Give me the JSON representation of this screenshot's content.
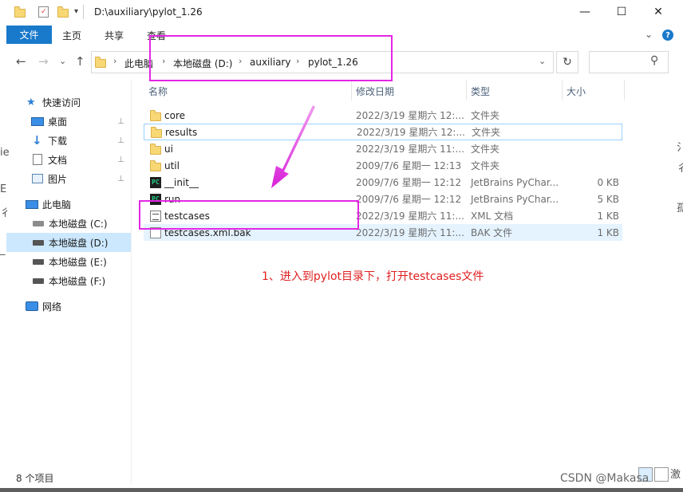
{
  "window": {
    "title": "D:\\auxiliary\\pylot_1.26",
    "minimize": "—",
    "maximize": "☐",
    "close": "✕"
  },
  "ribbon": {
    "tabs": [
      "文件",
      "主页",
      "共享",
      "查看"
    ],
    "expand": "⌄",
    "help": "?"
  },
  "address": {
    "back": "←",
    "forward": "→",
    "recent": "⌄",
    "up": "↑",
    "crumbs": [
      "此电脑",
      "本地磁盘 (D:)",
      "auxiliary",
      "pylot_1.26"
    ],
    "sep": "›",
    "dropdown": "⌄",
    "refresh": "↻",
    "search_icon": "⚲"
  },
  "nav": {
    "items": [
      {
        "label": "快速访问",
        "icon": "star-icon",
        "pinned": false,
        "selected": false
      },
      {
        "label": "桌面",
        "icon": "desktop-icon",
        "pinned": true,
        "selected": false
      },
      {
        "label": "下载",
        "icon": "download-icon",
        "pinned": true,
        "selected": false
      },
      {
        "label": "文档",
        "icon": "document-icon",
        "pinned": true,
        "selected": false
      },
      {
        "label": "图片",
        "icon": "pictures-icon",
        "pinned": true,
        "selected": false
      },
      {
        "label": "此电脑",
        "icon": "computer-icon",
        "pinned": false,
        "selected": false
      },
      {
        "label": "本地磁盘 (C:)",
        "icon": "drive-icon",
        "pinned": false,
        "selected": false
      },
      {
        "label": "本地磁盘 (D:)",
        "icon": "drive-icon",
        "pinned": false,
        "selected": true
      },
      {
        "label": "本地磁盘 (E:)",
        "icon": "drive-icon",
        "pinned": false,
        "selected": false
      },
      {
        "label": "本地磁盘 (F:)",
        "icon": "drive-icon",
        "pinned": false,
        "selected": false
      },
      {
        "label": "网络",
        "icon": "network-icon",
        "pinned": false,
        "selected": false
      }
    ],
    "pin_glyph": "📌"
  },
  "columns": {
    "name": "名称",
    "date": "修改日期",
    "type": "类型",
    "size": "大小"
  },
  "files": [
    {
      "name": "core",
      "date": "2022/3/19 星期六 12:...",
      "type": "文件夹",
      "size": "",
      "icon": "folder-icon"
    },
    {
      "name": "results",
      "date": "2022/3/19 星期六 12:...",
      "type": "文件夹",
      "size": "",
      "icon": "folder-icon"
    },
    {
      "name": "ui",
      "date": "2022/3/19 星期六 11:...",
      "type": "文件夹",
      "size": "",
      "icon": "folder-icon"
    },
    {
      "name": "util",
      "date": "2009/7/6 星期一 12:13",
      "type": "文件夹",
      "size": "",
      "icon": "folder-icon"
    },
    {
      "name": "__init__",
      "date": "2009/7/6 星期一 12:12",
      "type": "JetBrains PyChar...",
      "size": "0 KB",
      "icon": "pycharm-icon"
    },
    {
      "name": "run",
      "date": "2009/7/6 星期一 12:12",
      "type": "JetBrains PyChar...",
      "size": "5 KB",
      "icon": "pycharm-icon"
    },
    {
      "name": "testcases",
      "date": "2022/3/19 星期六 11:...",
      "type": "XML 文档",
      "size": "1 KB",
      "icon": "xml-file-icon"
    },
    {
      "name": "testcases.xml.bak",
      "date": "2022/3/19 星期六 11:...",
      "type": "BAK 文件",
      "size": "1 KB",
      "icon": "bak-file-icon"
    }
  ],
  "pc_icon_text": "PC",
  "annotation": {
    "text": "1、进入到pylot目录下，打开testcases文件",
    "color": "#e02020",
    "box_color": "#e426e4"
  },
  "status": {
    "count": "8 个项目"
  },
  "watermark": "CSDN @Makasa",
  "edge_chars": {
    "right": [
      "氵",
      "彳",
      "孤"
    ],
    "left": [
      "ie",
      "E",
      "彳",
      "_"
    ],
    "bottom_right": "激"
  },
  "colors": {
    "accent": "#1979ca",
    "selection": "#cce8ff"
  }
}
